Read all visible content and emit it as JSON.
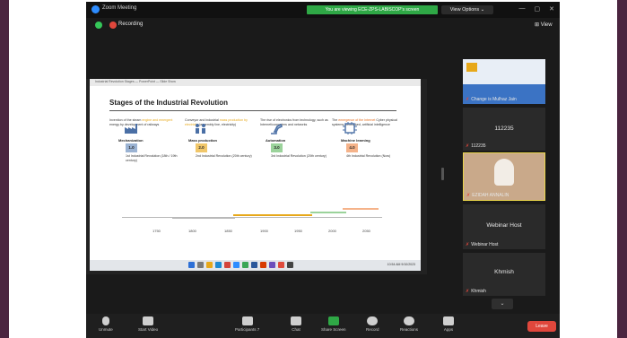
{
  "window": {
    "title": "Zoom Meeting",
    "share_banner": "You are viewing ECE-ZPS-LABISCOP's screen",
    "view_options": "View Options ⌄",
    "controls": [
      "—",
      "▢",
      "✕"
    ]
  },
  "info": {
    "recording": "Recording",
    "view": "⊞ View"
  },
  "slide": {
    "chrome_title": "Industrial Revolution Stages — PowerPoint — Slide Show",
    "title": "Stages of the Industrial Revolution",
    "stages": [
      {
        "desc_pre": "Invention of the steam",
        "desc_mid": "engine and emergent",
        "desc_post": "energy by development of railways",
        "label": "Mechanization",
        "num": "1.0",
        "num_color": "#9bb3d3",
        "rev": "1st Industrial Revolution (18th / 19th century)"
      },
      {
        "desc_pre": "Conveyor and industrial",
        "desc_mid": "mass production by electricity",
        "desc_post": "(assembly line, electricity)",
        "label": "Mass production",
        "num": "2.0",
        "num_color": "#f1c76a",
        "rev": "2nd Industrial Revolution (20th century)"
      },
      {
        "desc_pre": "The rise of electronics",
        "desc_mid": "from technology, such as",
        "desc_post": "Internet/computers and networks",
        "label": "Automation",
        "num": "3.0",
        "num_color": "#9bd39b",
        "rev": "3rd Industrial Revolution (20th century)"
      },
      {
        "desc_pre": "The",
        "desc_mid": "emergence of the Internet",
        "desc_post": "Cyber physical systems, networked, artificial intelligence",
        "label": "Machine learning",
        "num": "4.0",
        "num_color": "#f5b38a",
        "rev": "4th Industrial Revolution (Now)"
      }
    ],
    "years": [
      "1750",
      "1800",
      "1850",
      "1900",
      "1950",
      "2000",
      "2050"
    ]
  },
  "taskbar": {
    "clock": "10:54 AM 9/10/2023"
  },
  "participants": [
    {
      "name": "Change is Mulhaz Jain"
    },
    {
      "center": "112235",
      "name": "112235"
    },
    {
      "name": "EZIDAH ANNALIN"
    },
    {
      "center": "Webinar Host",
      "name": "Webinar Host"
    },
    {
      "center": "Khmish",
      "name": "Khmish"
    }
  ],
  "toolbar": {
    "mute": "Unmute",
    "video": "Start Video",
    "participants": "Participants",
    "participant_count": "7",
    "chat": "Chat",
    "share": "Share Screen",
    "record": "Record",
    "reactions": "Reactions",
    "apps": "Apps",
    "end": "Leave"
  }
}
